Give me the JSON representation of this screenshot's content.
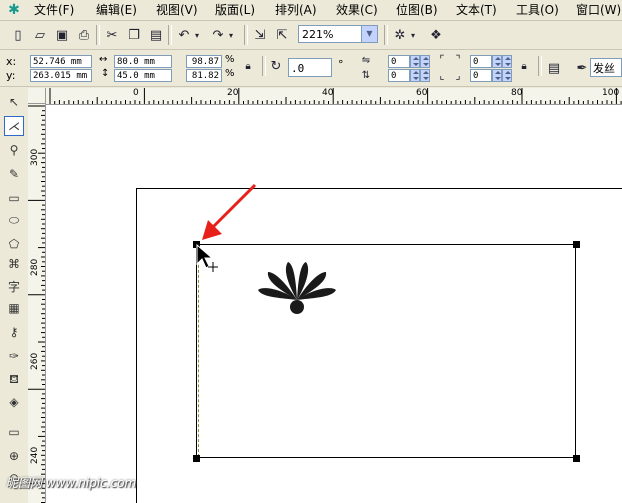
{
  "menu": {
    "items": [
      "文件(F)",
      "编辑(E)",
      "视图(V)",
      "版面(L)",
      "排列(A)",
      "效果(C)",
      "位图(B)",
      "文本(T)",
      "工具(O)",
      "窗口(W)"
    ]
  },
  "toolbar": {
    "zoom": "221%"
  },
  "property_bar": {
    "x_label": "x:",
    "y_label": "y:",
    "x_value": "52.746 mm",
    "y_value": "263.015 mm",
    "width": "80.0 mm",
    "height": "45.0 mm",
    "scale_x": "98.87",
    "scale_y": "81.82",
    "percent": "%",
    "rotation": ".0",
    "degree": "°",
    "corner_tl": "0",
    "corner_bl": "0",
    "corner_tr": "0",
    "corner_br": "0",
    "outline": "发丝"
  },
  "rulers": {
    "h_ticks": [
      "0",
      "20",
      "40",
      "60",
      "80",
      "100"
    ],
    "v_ticks": [
      "300",
      "280",
      "260",
      "240"
    ]
  },
  "watermark": "昵图网 www.nipic.com",
  "colors": {
    "accent_arrow": "#E8201A",
    "chrome": "#ECE9D8",
    "page_bg": "#FFFFFF"
  },
  "icons": [
    "new-icon",
    "open-icon",
    "save-icon",
    "print-icon",
    "cut-icon",
    "copy-icon",
    "paste-icon",
    "undo-icon",
    "redo-icon",
    "import-icon",
    "export-icon",
    "pick-tool-icon",
    "shape-tool-icon",
    "zoom-tool-icon",
    "freehand-tool-icon",
    "rectangle-tool-icon",
    "ellipse-tool-icon",
    "polygon-tool-icon",
    "text-tool-icon",
    "fill-tool-icon",
    "outline-tool-icon"
  ]
}
